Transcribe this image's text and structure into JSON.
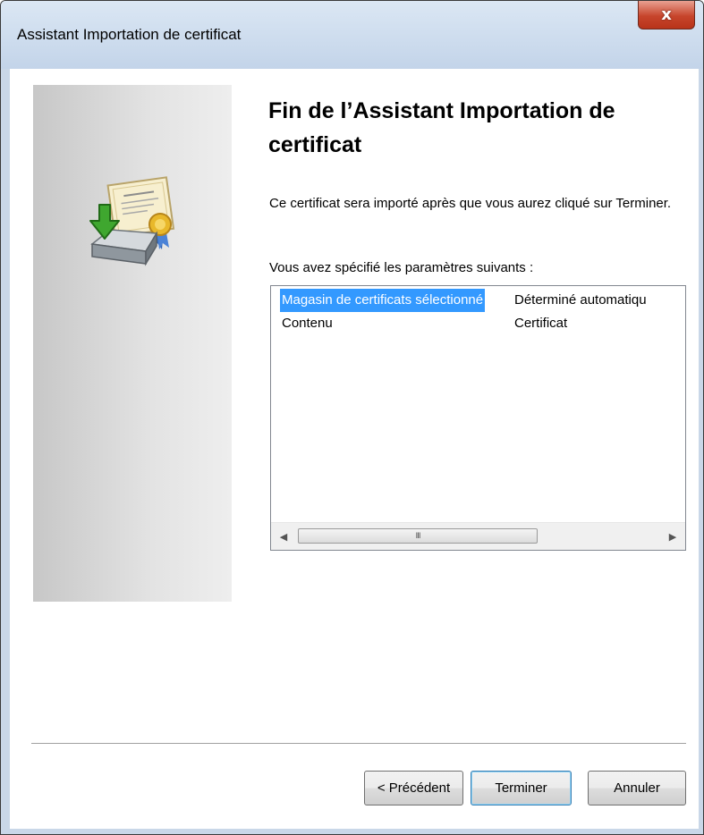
{
  "window": {
    "title": "Assistant Importation de certificat",
    "close_glyph": "x"
  },
  "icon": "certificate-import-icon",
  "heading": "Fin de l’Assistant Importation de certificat",
  "description": "Ce certificat sera importé après que vous aurez cliqué sur Terminer.",
  "settings_label": "Vous avez spécifié les paramètres suivants :",
  "settings": [
    {
      "name": "Magasin de certificats sélectionné",
      "value": "Déterminé automatiqu",
      "selected": true
    },
    {
      "name": "Contenu",
      "value": "Certificat",
      "selected": false
    }
  ],
  "scrollbar": {
    "left_arrow": "◀",
    "right_arrow": "▶",
    "grip": "III"
  },
  "buttons": {
    "previous": "< Précédent",
    "finish": "Terminer",
    "cancel": "Annuler"
  },
  "colors": {
    "selection": "#3399ff",
    "close": "#c7452c"
  }
}
